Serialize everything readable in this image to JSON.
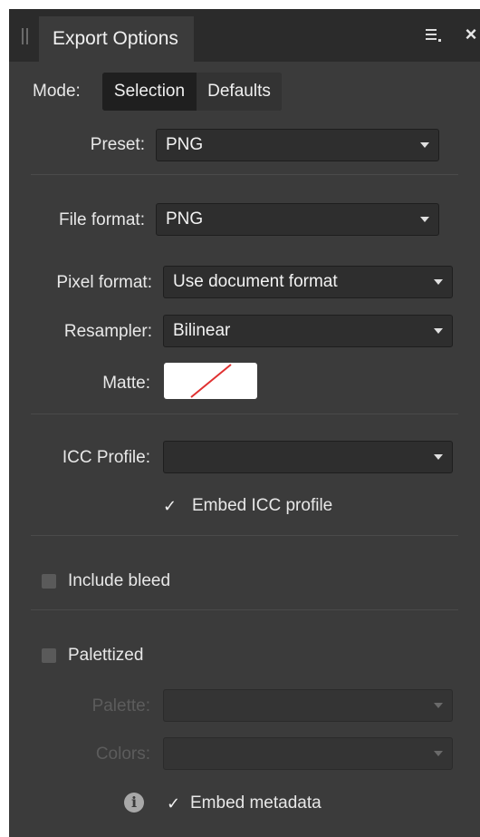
{
  "panel": {
    "tab_title": "Export Options",
    "close_glyph": "×",
    "icons": {
      "menu": "hamburger-menu-icon",
      "close": "close-icon",
      "grip": "drag-grip-icon"
    }
  },
  "mode": {
    "label": "Mode:",
    "options": [
      "Selection",
      "Defaults"
    ],
    "selected": "Selection"
  },
  "preset": {
    "label": "Preset:",
    "value": "PNG"
  },
  "file_format": {
    "label": "File format:",
    "value": "PNG"
  },
  "pixel_format": {
    "label": "Pixel format:",
    "value": "Use document format"
  },
  "resampler": {
    "label": "Resampler:",
    "value": "Bilinear"
  },
  "matte": {
    "label": "Matte:",
    "value_indicator": "none"
  },
  "icc_profile": {
    "label": "ICC Profile:",
    "value": ""
  },
  "embed_icc": {
    "label": "Embed ICC profile",
    "checked": true
  },
  "include_bleed": {
    "label": "Include bleed",
    "checked": false
  },
  "palettized": {
    "label": "Palettized",
    "checked": false
  },
  "palette": {
    "label": "Palette:",
    "value": "",
    "disabled": true
  },
  "colors": {
    "label": "Colors:",
    "value": "",
    "disabled": true
  },
  "embed_metadata": {
    "label": "Embed metadata",
    "checked": true
  },
  "info_glyph": "i",
  "check_glyph": "✓",
  "colors_theme": {
    "panel_bg": "#3b3b3b",
    "title_bg": "#2b2b2b",
    "matte_slash": "#e03030"
  }
}
